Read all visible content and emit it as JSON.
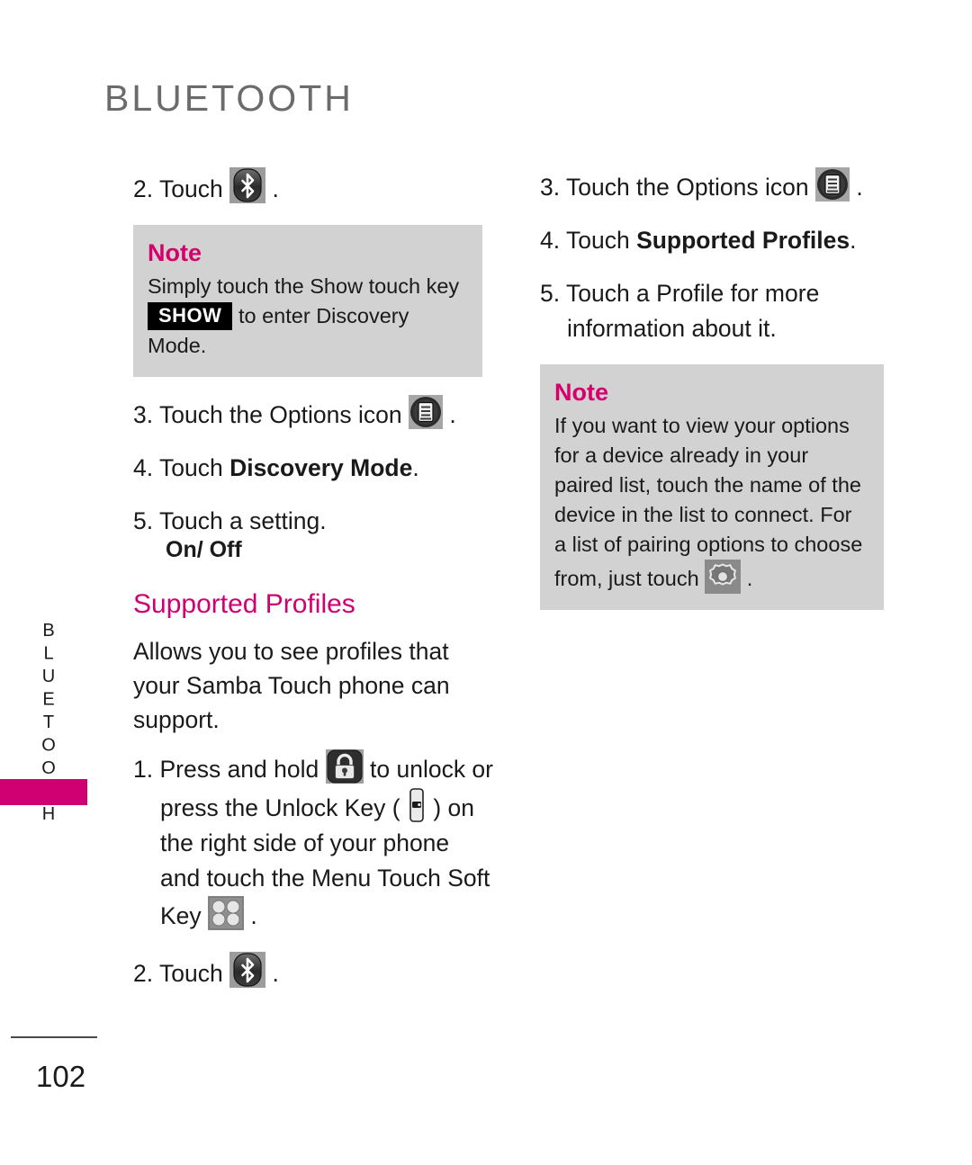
{
  "document": {
    "title": "BLUETOOTH",
    "side_tab_label": "BLUETOOTH",
    "page_number": "102",
    "accent_color": "#cf0072",
    "note_bg_color": "#d2d2d2",
    "title_color": "#6b6b6b"
  },
  "left_column": {
    "step2_a": "2. Touch",
    "step2_a_end": ".",
    "note1": {
      "title": "Note",
      "line1": "Simply touch the Show touch key",
      "badge": "SHOW",
      "line2": "to enter Discovery Mode."
    },
    "step3": "3. Touch the Options icon",
    "step3_end": ".",
    "step4_prefix": "4. Touch ",
    "step4_bold": "Discovery Mode",
    "step4_end": ".",
    "step5": "5. Touch a setting.",
    "step5_sub": "On/ Off",
    "section_heading": "Supported Profiles",
    "section_para": "Allows you to see profiles that your Samba Touch phone can support.",
    "step1_part1": "1. Press and hold",
    "step1_part2": "to unlock or press the Unlock Key (",
    "step1_part3": ") on the right side of your phone and touch the Menu Touch Soft Key",
    "step1_end": ".",
    "step2_b": "2. Touch",
    "step2_b_end": "."
  },
  "right_column": {
    "step3": "3. Touch the Options icon",
    "step3_end": ".",
    "step4_prefix": "4. Touch ",
    "step4_bold": "Supported Profiles",
    "step4_end": ".",
    "step5": "5. Touch a Profile for more information about it.",
    "note2": {
      "title": "Note",
      "line1": "If you want to view your options for a device already in your paired list, touch the name of the device in the list to connect. For a list of pairing options to choose from, just touch",
      "line2": "."
    }
  },
  "icons": {
    "bluetooth": "bluetooth-icon",
    "options": "options-icon",
    "lock": "lock-icon",
    "unlock_key": "unlock-key-icon",
    "menu_soft_key": "menu-soft-key-icon",
    "gear": "gear-icon"
  }
}
